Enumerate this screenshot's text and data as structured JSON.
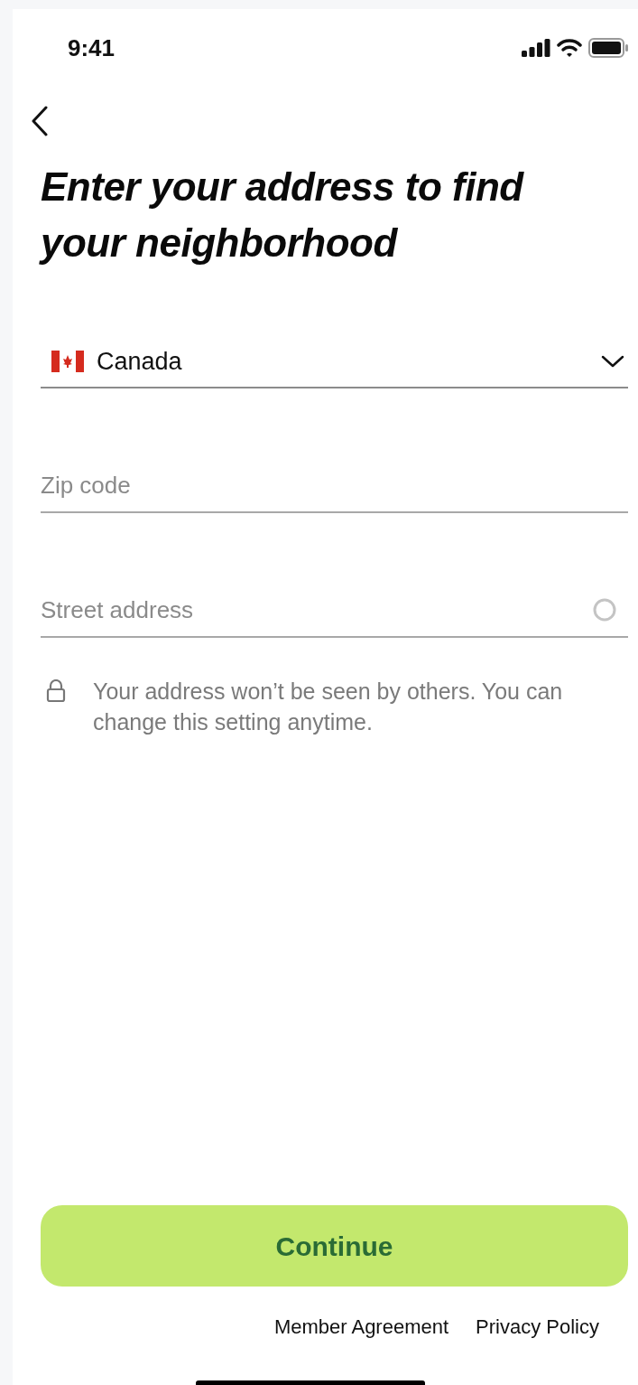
{
  "status_bar": {
    "time": "9:41"
  },
  "title": "Enter your address to find your neighborhood",
  "fields": [
    {
      "kind": "select",
      "value": "Canada"
    },
    {
      "kind": "text",
      "placeholder": "Zip code"
    },
    {
      "kind": "lookup",
      "placeholder": "Street address"
    }
  ],
  "privacy_note": "Your address won’t be seen by others. You can change this setting anytime.",
  "continue_button": "Continue",
  "footer_links": [
    "Member Agreement",
    "Privacy Policy"
  ]
}
